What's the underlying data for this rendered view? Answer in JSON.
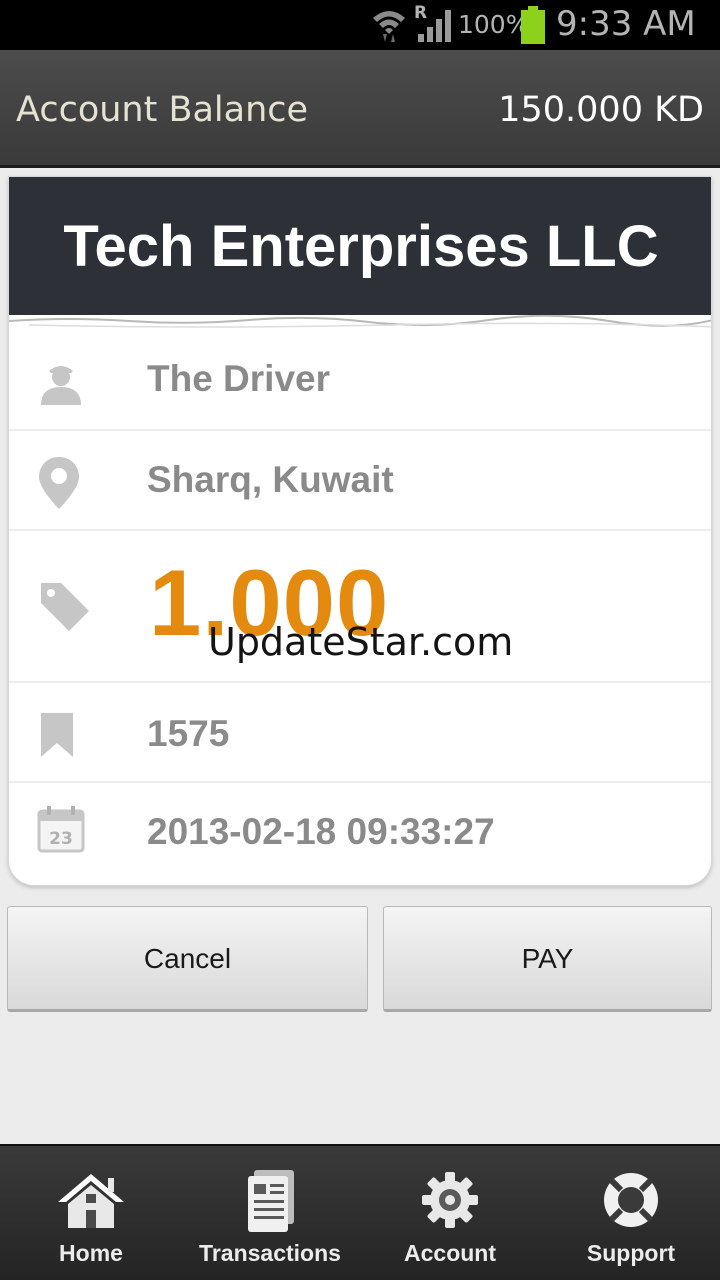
{
  "status_bar": {
    "roaming": "R",
    "battery_percent": "100%",
    "battery_level": 1.0,
    "time": "9:33 AM",
    "icons": [
      "wifi-icon",
      "signal-icon",
      "battery-icon"
    ]
  },
  "header": {
    "title": "Account Balance",
    "balance": "150.000 KD"
  },
  "payment": {
    "merchant": "Tech Enterprises LLC",
    "driver": "The Driver",
    "location": "Sharq, Kuwait",
    "amount": "1.000",
    "reference": "1575",
    "datetime": "2013-02-18 09:33:27"
  },
  "watermark": "UpdateStar.com",
  "actions": {
    "cancel_label": "Cancel",
    "pay_label": "PAY"
  },
  "nav": {
    "items": [
      {
        "label": "Home",
        "icon": "home-icon"
      },
      {
        "label": "Transactions",
        "icon": "transactions-icon"
      },
      {
        "label": "Account",
        "icon": "gear-icon"
      },
      {
        "label": "Support",
        "icon": "lifebuoy-icon"
      }
    ]
  },
  "colors": {
    "header_bg": "#3f3f3f",
    "card_title_bg": "#2e3038",
    "amount": "#e38a0f",
    "battery": "#8cd21c"
  }
}
